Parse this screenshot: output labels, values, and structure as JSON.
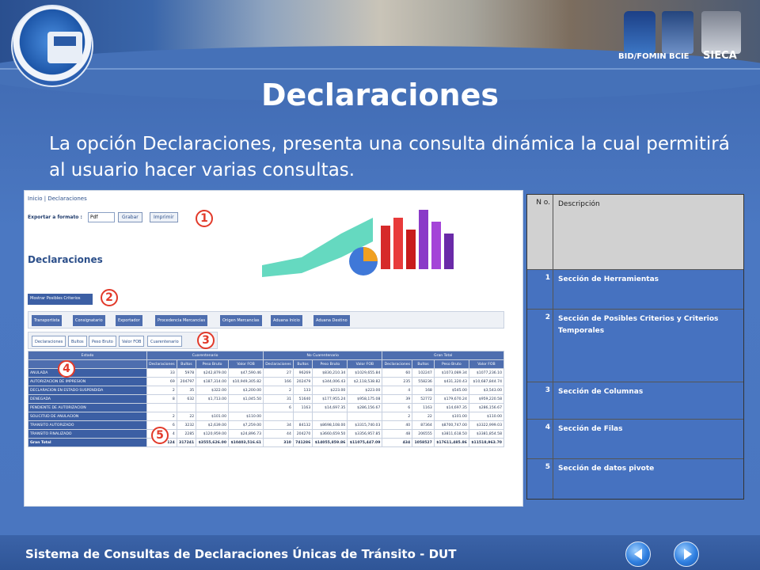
{
  "banner": {
    "partners": [
      "BID/FOMIN",
      "BCIE",
      "SIECA"
    ],
    "logo": "Modernización de Aduanas y Pasos Fronterizos"
  },
  "slide": {
    "title": "Declaraciones",
    "intro": "La opción Declaraciones, presenta una consulta dinámica la cual permitirá al usuario hacer varias consultas."
  },
  "screenshot": {
    "breadcrumb": "Inicio | Declaraciones",
    "export_label": "Exportar a formato :",
    "format_value": "Pdf",
    "grabar": "Grabar",
    "imprimir": "Imprimir",
    "heading": "Declaraciones",
    "mostrar": "Mostrar Posibles Criterios",
    "filters": [
      "Transportista",
      "Consignatario",
      "Exportador",
      "Procedencia Mercancías",
      "Origen Mercancías",
      "Aduana Inicio",
      "Aduana Destino"
    ],
    "columns": [
      "Declaraciones",
      "Bultos",
      "Peso Bruto",
      "Valor FOB",
      "Cuarentenario"
    ],
    "row_field": "Estado",
    "markers": [
      "1",
      "2",
      "3",
      "4",
      "5"
    ],
    "groups": [
      "Cuarentenario",
      "No Cuarentenario",
      "Gran Total"
    ],
    "subheaders": [
      "Declaraciones",
      "Bultos",
      "Peso Bruto",
      "Valor FOB"
    ],
    "rows": [
      {
        "label": "ANULADA",
        "v": [
          "33",
          "5978",
          "$242,879.00",
          "$47,590.46",
          "27",
          "96269",
          "$830,210.34",
          "$1029,655.84",
          "60",
          "102247",
          "$1073,089.34",
          "$1077,236.10"
        ]
      },
      {
        "label": "AUTORIZACION DE IMPRESION",
        "v": [
          "69",
          "204797",
          "$187,314.00",
          "$10,949,305.82",
          "166",
          "202479",
          "$344,006.43",
          "$2,118,538.82",
          "235",
          "558236",
          "$431,320.43",
          "$10,687,844.74"
        ]
      },
      {
        "label": "DECLARACION EN ESTADO SUSPENDIDA",
        "v": [
          "2",
          "35",
          "$322.00",
          "$3,200.00",
          "2",
          "133",
          "$223.00",
          "$223.00",
          "4",
          "168",
          "$545.00",
          "$3,543.00"
        ]
      },
      {
        "label": "DENEGADA",
        "v": [
          "8",
          "632",
          "$1,713.00",
          "$1,045.50",
          "31",
          "51640",
          "$177,955.24",
          "$958,175.08",
          "39",
          "52772",
          "$179,670.24",
          "$959,220.58"
        ]
      },
      {
        "label": "PENDIENTE DE AUTORIZACION",
        "v": [
          "",
          "",
          "",
          "",
          "6",
          "1163",
          "$14,697.35",
          "$286,156.67",
          "6",
          "1163",
          "$14,697.35",
          "$286,156.67"
        ]
      },
      {
        "label": "SOLICITUD DE ANULACION",
        "v": [
          "2",
          "22",
          "$101.00",
          "$110.00",
          "",
          "",
          "",
          "",
          "2",
          "22",
          "$101.00",
          "$110.00"
        ]
      },
      {
        "label": "TRANSITO AUTORIZADO",
        "v": [
          "6",
          "3232",
          "$2,639.00",
          "$7,259.00",
          "34",
          "84132",
          "$8698,108.00",
          "$3315,740.03",
          "40",
          "87364",
          "$8700,747.00",
          "$3322,999.03"
        ]
      },
      {
        "label": "TRANSITO FINALIZADO",
        "v": [
          "4",
          "2285",
          "$120,959.00",
          "$24,896.73",
          "44",
          "204270",
          "$3660,659.50",
          "$3356,957.85",
          "48",
          "206555",
          "$3811,618.50",
          "$3381,854.58"
        ]
      },
      {
        "label": "Gran Total",
        "v": [
          "124",
          "317241",
          "$3555,626.00",
          "$10403,516.61",
          "310",
          "741286",
          "$14055,859.86",
          "$11075,447.09",
          "434",
          "1058527",
          "$17611,485.86",
          "$11518,963.70"
        ]
      }
    ]
  },
  "legend": {
    "header_no": "N o.",
    "header_desc": "Descripción",
    "items": [
      {
        "no": "1",
        "desc": "Sección de Herramientas"
      },
      {
        "no": "2",
        "desc": "Sección de Posibles Criterios y Criterios Temporales"
      },
      {
        "no": "3",
        "desc": "Sección de Columnas"
      },
      {
        "no": "4",
        "desc": "Sección de Filas"
      },
      {
        "no": "5",
        "desc": "Sección de datos pivote"
      }
    ]
  },
  "footer": {
    "text": "Sistema de Consultas de Declaraciones Únicas de Tránsito - DUT"
  },
  "icons": {
    "prev": "arrow-left-icon",
    "next": "arrow-right-icon"
  }
}
